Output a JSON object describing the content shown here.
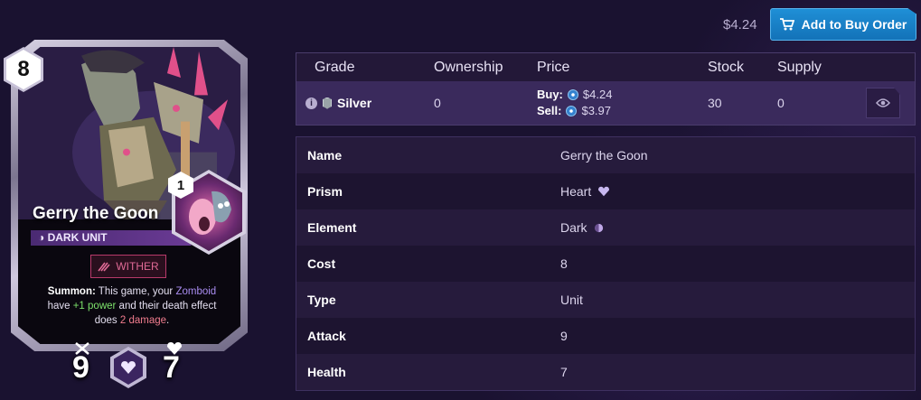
{
  "card": {
    "cost": "8",
    "level": "1",
    "name": "Gerry the Goon",
    "type_line": "DARK UNIT",
    "ability": "WITHER",
    "description_parts": {
      "summon_label": "Summon:",
      "text1": " This game, your ",
      "zomboid": "Zomboid",
      "text2": " have ",
      "power": "+1 power",
      "text3": " and their death effect does ",
      "damage": "2 damage",
      "text4": "."
    },
    "attack": "9",
    "health": "7"
  },
  "topbar": {
    "price": "$4.24",
    "buy_button_label": "Add to Buy Order"
  },
  "grade_table": {
    "headers": {
      "grade": "Grade",
      "ownership": "Ownership",
      "price": "Price",
      "stock": "Stock",
      "supply": "Supply"
    },
    "row": {
      "grade": "Silver",
      "ownership": "0",
      "buy_label": "Buy:",
      "buy_price": "$4.24",
      "sell_label": "Sell:",
      "sell_price": "$3.97",
      "stock": "30",
      "supply": "0"
    }
  },
  "details": {
    "name_key": "Name",
    "name_val": "Gerry the Goon",
    "prism_key": "Prism",
    "prism_val": "Heart",
    "element_key": "Element",
    "element_val": "Dark",
    "cost_key": "Cost",
    "cost_val": "8",
    "type_key": "Type",
    "type_val": "Unit",
    "attack_key": "Attack",
    "attack_val": "9",
    "health_key": "Health",
    "health_val": "7"
  },
  "colors": {
    "accent_blue": "#1f8fd6",
    "row_highlight": "#3a2a5c",
    "ability_red": "#b83a6a"
  }
}
